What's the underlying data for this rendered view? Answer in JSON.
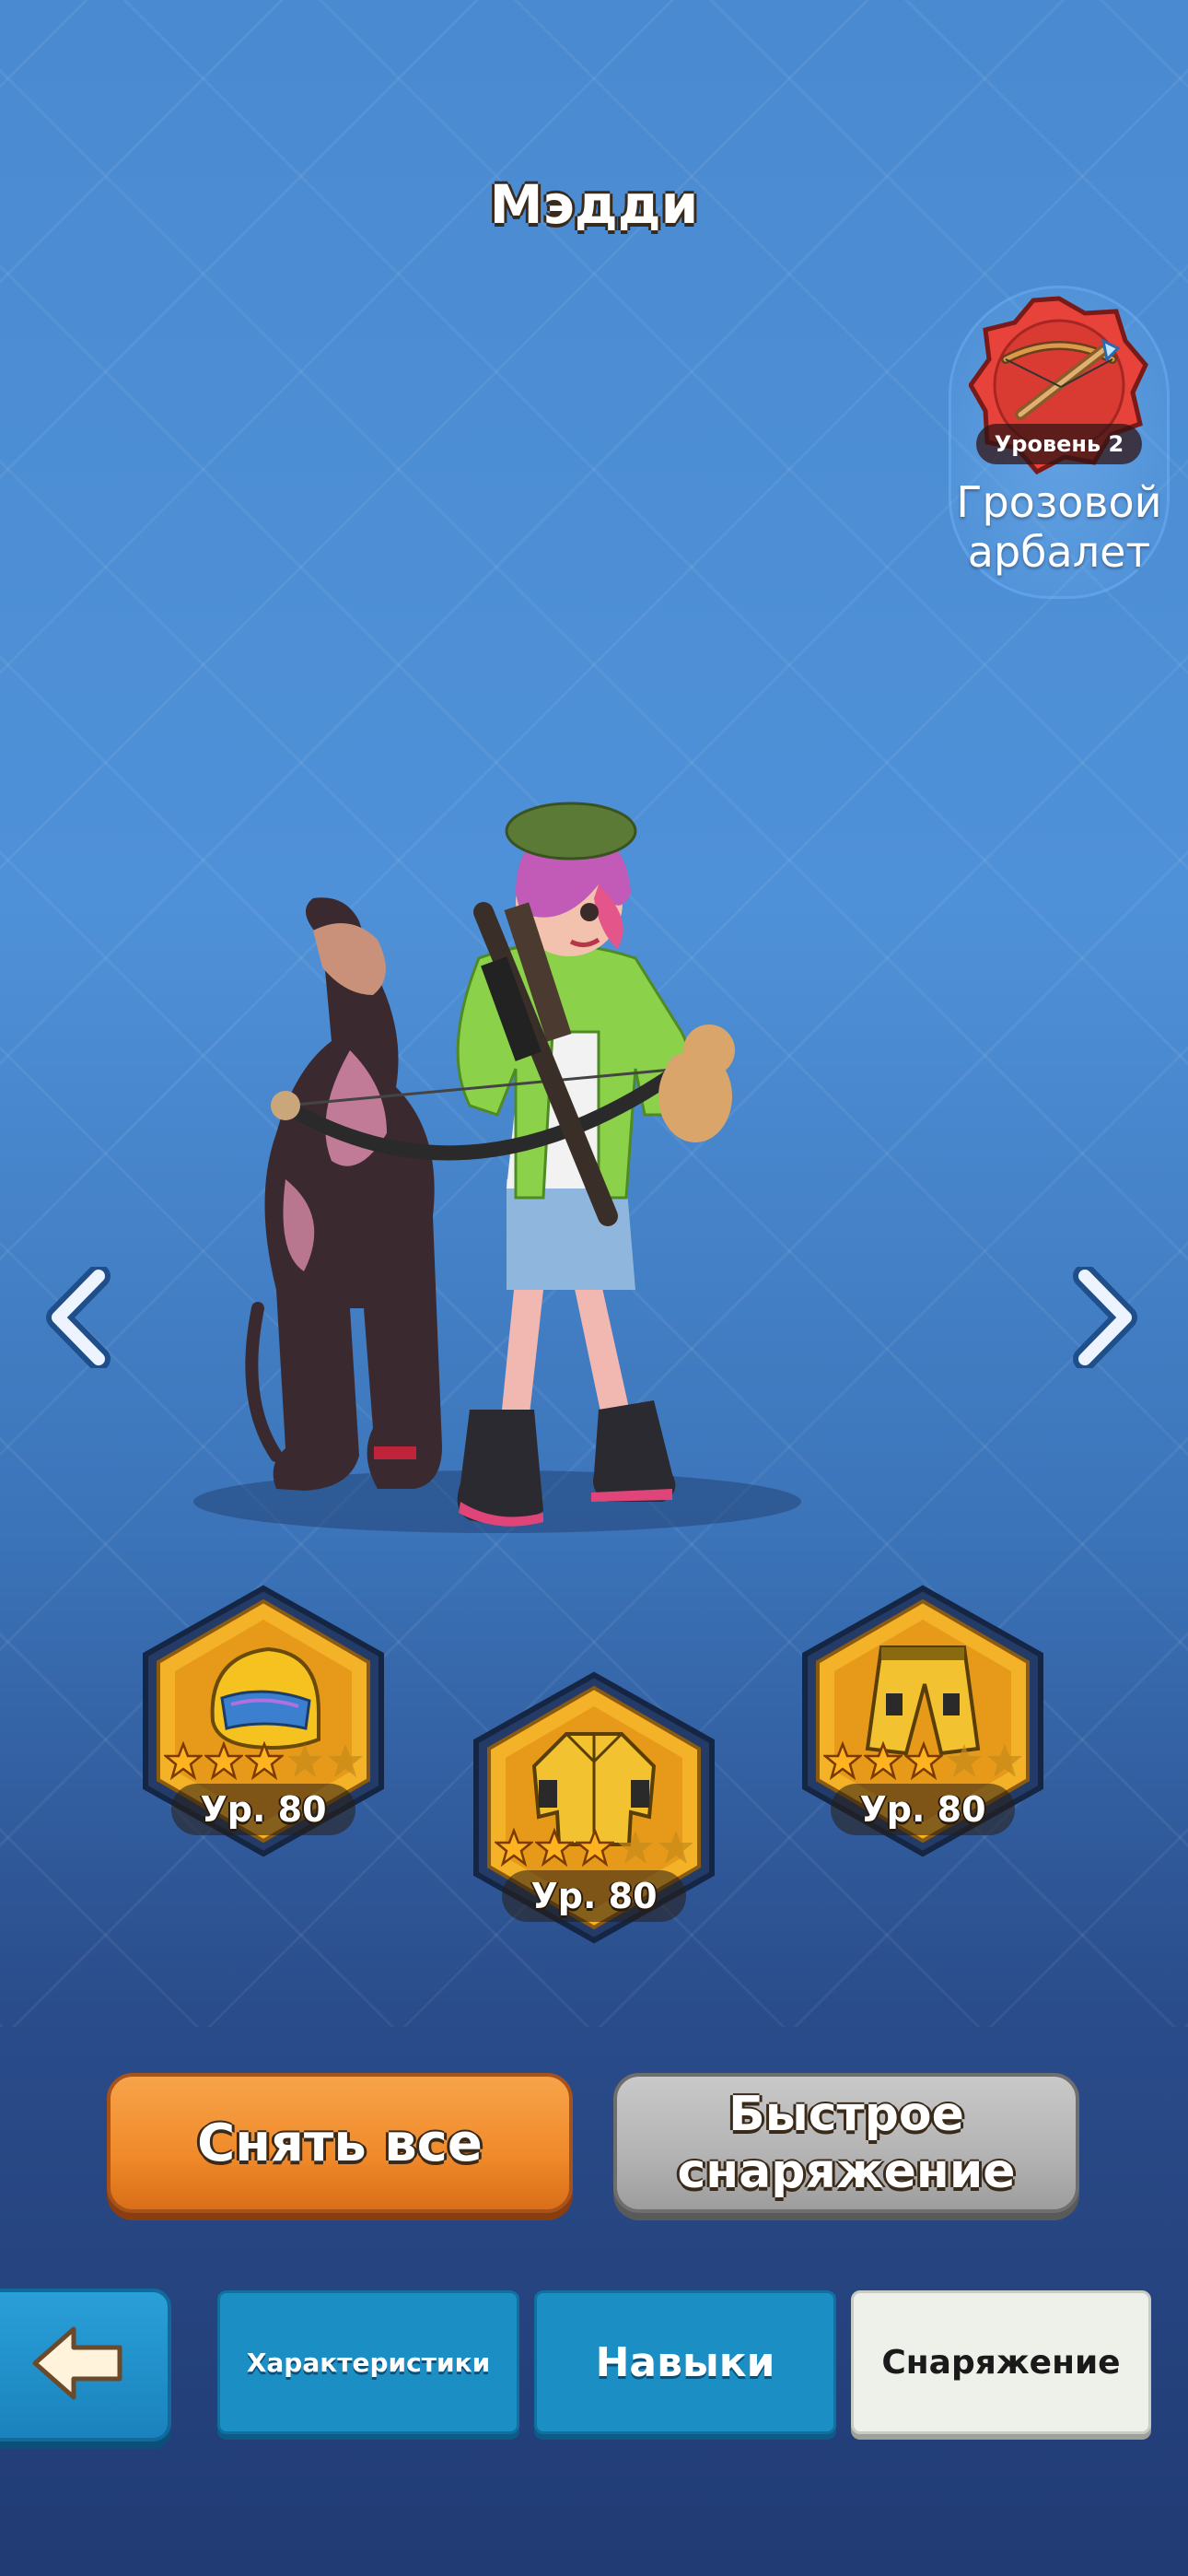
{
  "header": {
    "title": "Мэдди"
  },
  "weapon": {
    "level_label": "Уровень 2",
    "name": "Грозовой арбалет"
  },
  "navigation": {
    "prev_icon": "chevron-left-icon",
    "next_icon": "chevron-right-icon"
  },
  "gear": {
    "slots": [
      {
        "item": "helmet",
        "stars": 3,
        "max_stars": 5,
        "level_label": "Ур. 80"
      },
      {
        "item": "jacket",
        "stars": 3,
        "max_stars": 5,
        "level_label": "Ур. 80"
      },
      {
        "item": "pants",
        "stars": 3,
        "max_stars": 5,
        "level_label": "Ур. 80"
      }
    ]
  },
  "actions": {
    "unequip_all": "Снять все",
    "quick_equip": "Быстрое снаряжение"
  },
  "tabs": {
    "back_icon": "arrow-left-icon",
    "stats": "Характеристики",
    "skills": "Навыки",
    "gear": "Снаряжение",
    "active": "gear"
  },
  "colors": {
    "background_top": "#4a8ad0",
    "background_bottom": "#213b74",
    "slot_gold": "#f3b227",
    "button_orange": "#f08a2a",
    "button_gray": "#b3b3b3",
    "tab_blue": "#1b8fc4",
    "tab_active": "#eef0ea"
  }
}
